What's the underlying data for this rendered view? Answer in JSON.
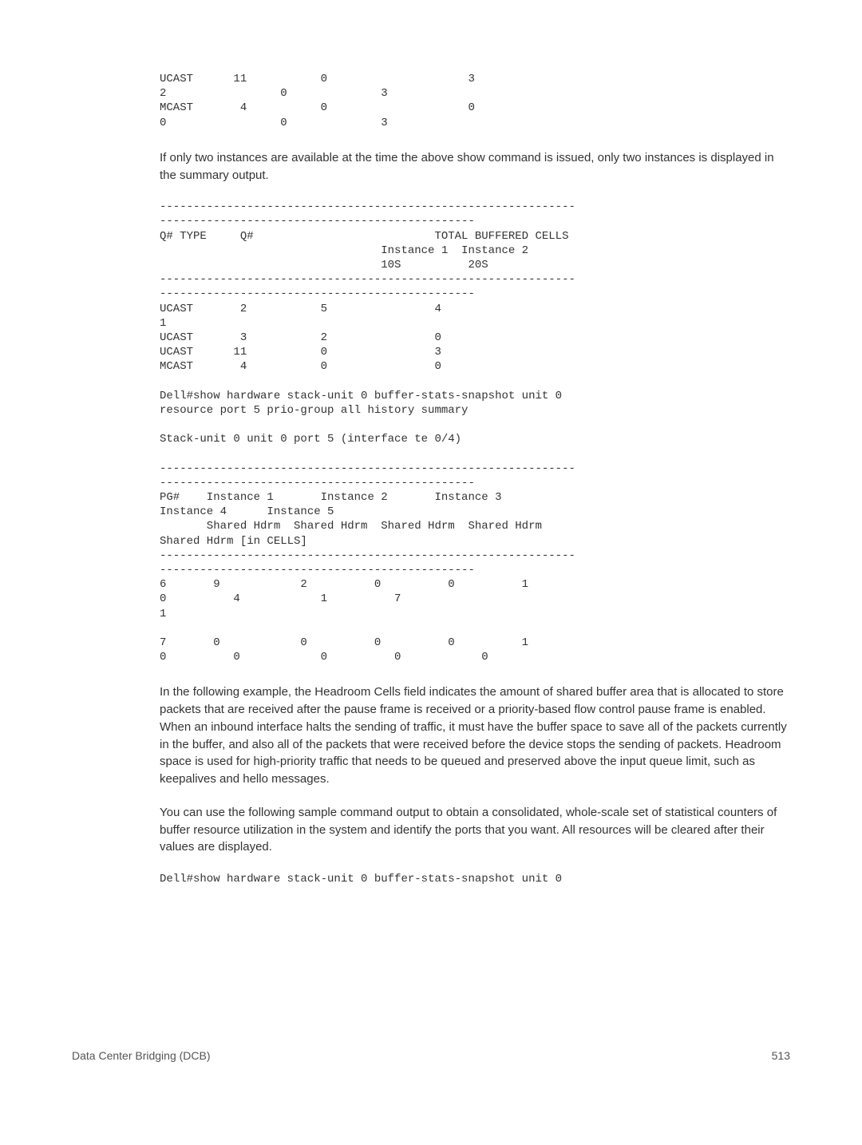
{
  "code_block_1": "UCAST      11           0                     3\n2                 0              3\nMCAST       4           0                     0\n0                 0              3",
  "para_1": "If only two instances are available at the time the above show command is issued, only two instances is displayed in the summary output.",
  "code_block_2": "--------------------------------------------------------------\n-----------------------------------------------\nQ# TYPE     Q#                           TOTAL BUFFERED CELLS\n                                 Instance 1  Instance 2\n                                 10S          20S\n--------------------------------------------------------------\n-----------------------------------------------\nUCAST       2           5                4\n1\nUCAST       3           2                0\nUCAST      11           0                3\nMCAST       4           0                0\n\nDell#show hardware stack-unit 0 buffer-stats-snapshot unit 0\nresource port 5 prio-group all history summary\n\nStack-unit 0 unit 0 port 5 (interface te 0/4)\n\n--------------------------------------------------------------\n-----------------------------------------------\nPG#    Instance 1       Instance 2       Instance 3\nInstance 4      Instance 5\n       Shared Hdrm  Shared Hdrm  Shared Hdrm  Shared Hdrm\nShared Hdrm [in CELLS]\n--------------------------------------------------------------\n-----------------------------------------------\n6       9            2          0          0          1\n0          4            1          7\n1\n\n7       0            0          0          0          1\n0          0            0          0            0",
  "para_2": "In the following example, the Headroom Cells field indicates the amount of shared buffer area that is allocated to store packets that are received after the pause frame is received or a priority-based flow control pause frame is enabled. When an inbound interface halts the sending of traffic, it must have the buffer space to save all of the packets currently in the buffer, and also all of the packets that were received before the device stops the sending of packets. Headroom space is used for high-priority traffic that needs to be queued and preserved above the input queue limit, such as keepalives and hello messages.",
  "para_3": "You can use the following sample command output to obtain a consolidated, whole-scale set of statistical counters of buffer resource utilization in the system and identify the ports that you want. All resources will be cleared after their values are displayed.",
  "code_block_3": "Dell#show hardware stack-unit 0 buffer-stats-snapshot unit 0",
  "footer": {
    "left": "Data Center Bridging (DCB)",
    "right": "513"
  }
}
